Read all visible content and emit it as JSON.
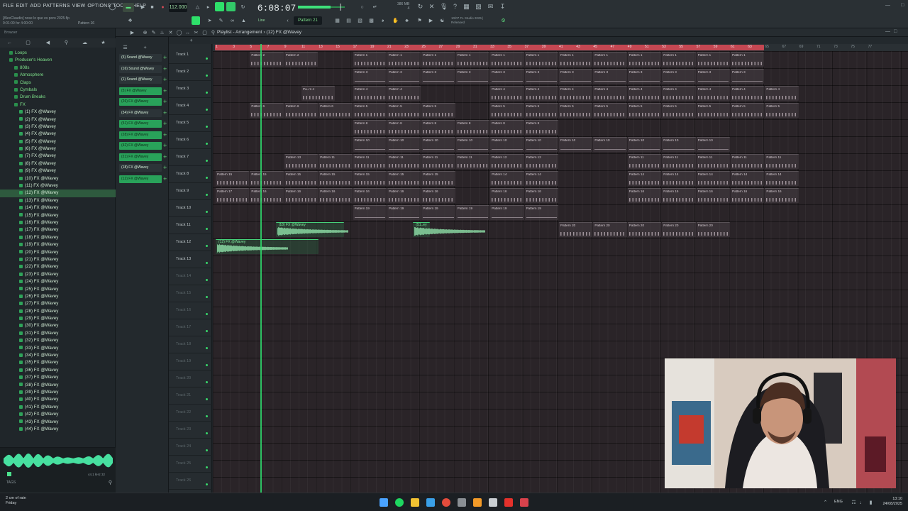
{
  "menu": [
    "FILE",
    "EDIT",
    "ADD",
    "PATTERNS",
    "VIEW",
    "OPTIONS",
    "TOOLS",
    "HELP"
  ],
  "hint": [
    "[AlexClaudio] nose lo que es poro 2025.flp",
    "9:01:00 for 4:00:00"
  ],
  "hint_pattern": "Pattern 16",
  "tempo": "112.000",
  "timecode": "6:08:07",
  "pattern_selector": "Pattern 21",
  "line_mode": "Line",
  "cpu_ram": [
    "386 MB",
    "4"
  ],
  "news": [
    "10/07 FL Studio 2025 |",
    "Released"
  ],
  "browser": {
    "label": "Browser",
    "items": [
      {
        "label": "Loops",
        "level": 1,
        "folder": true
      },
      {
        "label": "Producer's Heaven",
        "level": 1,
        "folder": true
      },
      {
        "label": "808s",
        "level": 2,
        "folder": true
      },
      {
        "label": "Atmosphere",
        "level": 2,
        "folder": true
      },
      {
        "label": "Claps",
        "level": 2,
        "folder": true
      },
      {
        "label": "Cymbals",
        "level": 2,
        "folder": true
      },
      {
        "label": "Drum Breaks",
        "level": 2,
        "folder": true
      },
      {
        "label": "FX",
        "level": 2,
        "folder": true
      },
      {
        "label": "(1) FX @Wavey",
        "level": 3
      },
      {
        "label": "(2) FX @Wavey",
        "level": 3
      },
      {
        "label": "(3) FX @Wavey",
        "level": 3
      },
      {
        "label": "(4) FX @Wavey",
        "level": 3
      },
      {
        "label": "(5) FX @Wavey",
        "level": 3
      },
      {
        "label": "(6) FX @Wavey",
        "level": 3
      },
      {
        "label": "(7) FX @Wavey",
        "level": 3
      },
      {
        "label": "(8) FX @Wavey",
        "level": 3
      },
      {
        "label": "(9) FX @Wavey",
        "level": 3
      },
      {
        "label": "(10) FX @Wavey",
        "level": 3
      },
      {
        "label": "(11) FX @Wavey",
        "level": 3
      },
      {
        "label": "(12) FX @Wavey",
        "level": 3,
        "selected": true
      },
      {
        "label": "(13) FX @Wavey",
        "level": 3
      },
      {
        "label": "(14) FX @Wavey",
        "level": 3
      },
      {
        "label": "(15) FX @Wavey",
        "level": 3
      },
      {
        "label": "(16) FX @Wavey",
        "level": 3
      },
      {
        "label": "(17) FX @Wavey",
        "level": 3
      },
      {
        "label": "(18) FX @Wavey",
        "level": 3
      },
      {
        "label": "(19) FX @Wavey",
        "level": 3
      },
      {
        "label": "(20) FX @Wavey",
        "level": 3
      },
      {
        "label": "(21) FX @Wavey",
        "level": 3
      },
      {
        "label": "(22) FX @Wavey",
        "level": 3
      },
      {
        "label": "(23) FX @Wavey",
        "level": 3
      },
      {
        "label": "(24) FX @Wavey",
        "level": 3
      },
      {
        "label": "(25) FX @Wavey",
        "level": 3
      },
      {
        "label": "(26) FX @Wavey",
        "level": 3
      },
      {
        "label": "(27) FX @Wavey",
        "level": 3
      },
      {
        "label": "(28) FX @Wavey",
        "level": 3
      },
      {
        "label": "(29) FX @Wavey",
        "level": 3
      },
      {
        "label": "(30) FX @Wavey",
        "level": 3
      },
      {
        "label": "(31) FX @Wavey",
        "level": 3
      },
      {
        "label": "(32) FX @Wavey",
        "level": 3
      },
      {
        "label": "(33) FX @Wavey",
        "level": 3
      },
      {
        "label": "(34) FX @Wavey",
        "level": 3
      },
      {
        "label": "(35) FX @Wavey",
        "level": 3
      },
      {
        "label": "(36) FX @Wavey",
        "level": 3
      },
      {
        "label": "(37) FX @Wavey",
        "level": 3
      },
      {
        "label": "(38) FX @Wavey",
        "level": 3
      },
      {
        "label": "(39) FX @Wavey",
        "level": 3
      },
      {
        "label": "(40) FX @Wavey",
        "level": 3
      },
      {
        "label": "(41) FX @Wavey",
        "level": 3
      },
      {
        "label": "(42) FX @Wavey",
        "level": 3
      },
      {
        "label": "(43) FX @Wavey",
        "level": 3
      },
      {
        "label": "(44) FX @Wavey",
        "level": 3
      }
    ],
    "tags_label": "TAGS",
    "sample_info": "44.1 kHz 32"
  },
  "picker": {
    "items": [
      {
        "label": "(5) Sound @Wavey",
        "green": false
      },
      {
        "label": "(16) Sound @Wavey",
        "green": false
      },
      {
        "label": "(1) Sound @Wavey",
        "green": false
      },
      {
        "label": "(5) FX @Wavey",
        "green": true
      },
      {
        "label": "(26) FX @Wavey",
        "green": true
      },
      {
        "label": "(34) FX @Wavey",
        "green": false
      },
      {
        "label": "(51) FX @Wavey",
        "green": true
      },
      {
        "label": "(28) FX @Wavey",
        "green": true
      },
      {
        "label": "(42) FX @Wavey",
        "green": true
      },
      {
        "label": "(21) FX @Wavey",
        "green": true
      },
      {
        "label": "(18) FX @Wavey",
        "green": false
      },
      {
        "label": "(12) FX @Wavey",
        "green": true
      }
    ]
  },
  "playlist": {
    "title": "Playlist - Arrangement › (12) FX @Wavey",
    "ruler": [
      "1",
      "3",
      "5",
      "7",
      "9",
      "11",
      "13",
      "15",
      "17",
      "19",
      "21",
      "23",
      "25",
      "27",
      "29",
      "31",
      "33",
      "35",
      "37",
      "39",
      "41",
      "43",
      "45",
      "47",
      "49",
      "51",
      "53",
      "55",
      "57",
      "59",
      "61",
      "63",
      "65",
      "67",
      "69",
      "71",
      "73",
      "75",
      "77"
    ],
    "tracks": [
      "Track 1",
      "Track 2",
      "Track 3",
      "Track 4",
      "Track 5",
      "Track 6",
      "Track 7",
      "Track 8",
      "Track 9",
      "Track 10",
      "Track 11",
      "Track 12",
      "Track 13",
      "Track 14",
      "Track 15",
      "Track 16",
      "Track 17",
      "Track 18",
      "Track 19",
      "Track 20",
      "Track 21",
      "Track 22",
      "Track 23",
      "Track 24",
      "Track 25",
      "Track 26"
    ],
    "patterns": [
      {
        "track": 1,
        "label": "Pattern 2",
        "starts": [
          5,
          9
        ]
      },
      {
        "track": 1,
        "label": "Pattern 1",
        "starts": [
          17,
          21,
          25,
          29,
          33,
          37,
          41,
          45,
          49,
          53,
          57,
          61
        ]
      },
      {
        "track": 2,
        "label": "Pattern 3",
        "starts": [
          17,
          21,
          25,
          29,
          33,
          37,
          41,
          45,
          49,
          53,
          57,
          61
        ]
      },
      {
        "track": 3,
        "label": "Pa..rn 4",
        "starts": [
          11
        ]
      },
      {
        "track": 3,
        "label": "Pattern 4",
        "starts": [
          17,
          21
        ]
      },
      {
        "track": 3,
        "label": "Pattern 4",
        "starts": [
          33,
          37,
          41,
          45,
          49,
          53,
          57,
          61,
          65
        ]
      },
      {
        "track": 4,
        "label": "Pattern 6",
        "starts": [
          5,
          9,
          13
        ]
      },
      {
        "track": 4,
        "label": "Pattern 5",
        "starts": [
          17,
          21,
          25,
          33,
          37,
          41,
          45,
          49,
          53,
          57,
          61,
          65
        ]
      },
      {
        "track": 5,
        "label": "Pattern 8",
        "starts": [
          17,
          21,
          25,
          29,
          33,
          37
        ]
      },
      {
        "track": 6,
        "label": "Pattern 10",
        "starts": [
          17,
          21,
          25,
          29,
          33,
          37,
          41,
          45,
          49,
          53,
          57
        ]
      },
      {
        "track": 7,
        "label": "Pattern 13",
        "starts": [
          9
        ]
      },
      {
        "track": 7,
        "label": "Pattern 11",
        "starts": [
          13,
          17,
          21,
          25,
          29
        ]
      },
      {
        "track": 7,
        "label": "Pattern 12",
        "starts": [
          33,
          37
        ]
      },
      {
        "track": 7,
        "label": "Pattern 11",
        "starts": [
          49,
          53,
          57,
          61,
          65
        ]
      },
      {
        "track": 8,
        "label": "Pattern 15",
        "starts": [
          1,
          5,
          9,
          13,
          17,
          21,
          25
        ]
      },
      {
        "track": 8,
        "label": "Pattern 14",
        "starts": [
          33,
          37
        ]
      },
      {
        "track": 8,
        "label": "Pattern 14",
        "starts": [
          49,
          53,
          57,
          61,
          65
        ]
      },
      {
        "track": 9,
        "label": "Pattern 17",
        "starts": [
          1
        ]
      },
      {
        "track": 9,
        "label": "Pattern 16",
        "starts": [
          5,
          9,
          13,
          17,
          21,
          25,
          33,
          37,
          49,
          53,
          57,
          61,
          65
        ]
      },
      {
        "track": 10,
        "label": "Pattern 19",
        "starts": [
          17,
          21,
          25,
          29,
          33,
          37
        ]
      },
      {
        "track": 11,
        "label": "Pattern 20",
        "starts": [
          41,
          45,
          49,
          53,
          57
        ]
      }
    ],
    "audio_clips": [
      {
        "track": 11,
        "label": "(18) FX @Wavey",
        "start": 8,
        "len": 8
      },
      {
        "track": 11,
        "label": "(51..ey",
        "start": 24,
        "len": 2
      },
      {
        "track": 12,
        "label": "(12) FX @Wavey",
        "start": 1,
        "len": 12
      }
    ]
  },
  "taskbar": {
    "weather": [
      "2 cm of rain",
      "Friday"
    ],
    "language": "ENG",
    "clock": [
      "13:10",
      "24/08/2025"
    ]
  },
  "colors": {
    "accent": "#2ee06a",
    "ruler": "#c44752",
    "clip": "#463e44"
  }
}
